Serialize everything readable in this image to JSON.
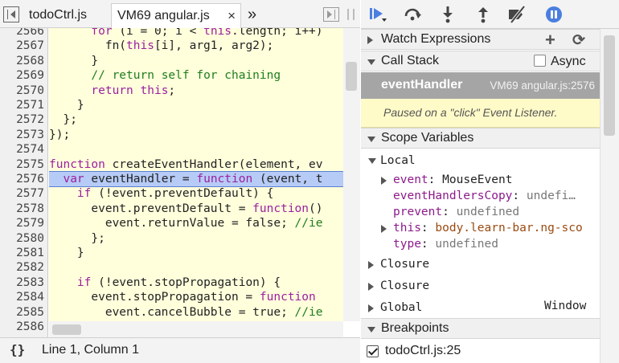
{
  "tabs": [
    {
      "label": "todoCtrl.js",
      "active": false
    },
    {
      "label": "VM69 angular.js",
      "active": true,
      "close": "×"
    }
  ],
  "tab_more": "»",
  "code": {
    "lines": [
      {
        "n": "2566",
        "html": "      <span class='kw'>for</span> (i = 0; i &lt; <span class='kw'>this</span>.length; i++)"
      },
      {
        "n": "2567",
        "html": "        fn(<span class='kw'>this</span>[i], arg1, arg2);"
      },
      {
        "n": "2568",
        "html": "      }"
      },
      {
        "n": "2569",
        "html": "      <span class='cm'>// return self for chaining</span>"
      },
      {
        "n": "2570",
        "html": "      <span class='kw'>return this</span>;"
      },
      {
        "n": "2571",
        "html": "    }"
      },
      {
        "n": "2572",
        "html": "  };"
      },
      {
        "n": "2573",
        "html": "});"
      },
      {
        "n": "2574",
        "html": ""
      },
      {
        "n": "2575",
        "html": "<span class='kw'>function</span> createEventHandler(element, ev"
      },
      {
        "n": "2576",
        "html": "  <span class='kw'>var</span> eventHandler = <span class='kw'>function</span> (event, t",
        "highlight": true
      },
      {
        "n": "2577",
        "html": "    <span class='kw'>if</span> (!event.preventDefault) {"
      },
      {
        "n": "2578",
        "html": "      event.preventDefault = <span class='kw'>function</span>()"
      },
      {
        "n": "2579",
        "html": "        event.returnValue = false; <span class='cm'>//ie</span>"
      },
      {
        "n": "2580",
        "html": "      };"
      },
      {
        "n": "2581",
        "html": "    }"
      },
      {
        "n": "2582",
        "html": ""
      },
      {
        "n": "2583",
        "html": "    <span class='kw'>if</span> (!event.stopPropagation) {"
      },
      {
        "n": "2584",
        "html": "      event.stopPropagation = <span class='kw'>function</span>"
      },
      {
        "n": "2585",
        "html": "        event.cancelBubble = true; <span class='cm'>//ie</span>"
      },
      {
        "n": "2586",
        "html": ""
      }
    ]
  },
  "status": {
    "pretty_print": "{}",
    "cursor": "Line 1, Column 1"
  },
  "toolbar": {
    "resume": "resume-icon",
    "step_over": "step-over-icon",
    "step_into": "step-into-icon",
    "step_out": "step-out-icon",
    "deactivate": "deactivate-breakpoints-icon",
    "pause_exceptions": "pause-on-exceptions-icon",
    "accent": "#4a7fe0"
  },
  "sidebar": {
    "watch": {
      "label": "Watch Expressions",
      "add": "+",
      "refresh": "⟳"
    },
    "call_stack": {
      "label": "Call Stack",
      "async_label": "Async",
      "frame": {
        "name": "eventHandler",
        "location": "VM69 angular.js:2576"
      },
      "paused_message": "Paused on a \"click\" Event Listener."
    },
    "scope": {
      "label": "Scope Variables",
      "local": {
        "label": "Local",
        "vars": [
          {
            "key": "event",
            "value": "MouseEvent",
            "kind": "val",
            "expandable": true
          },
          {
            "key": "eventHandlersCopy",
            "value": "undefi…",
            "kind": "und",
            "expandable": false
          },
          {
            "key": "prevent",
            "value": "undefined",
            "kind": "und",
            "expandable": false
          },
          {
            "key": "this",
            "value": "body.learn-bar.ng-sco",
            "kind": "cls",
            "expandable": true
          },
          {
            "key": "type",
            "value": "undefined",
            "kind": "und",
            "expandable": false
          }
        ]
      },
      "closures": [
        {
          "label": "Closure"
        },
        {
          "label": "Closure"
        }
      ],
      "global": {
        "label": "Global",
        "value": "Window"
      }
    },
    "breakpoints": {
      "label": "Breakpoints",
      "items": [
        {
          "label": "todoCtrl.js:25",
          "checked": true
        }
      ]
    }
  }
}
